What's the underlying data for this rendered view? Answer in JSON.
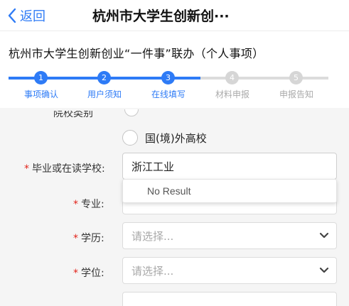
{
  "nav": {
    "back_label": "返回",
    "title": "杭州市大学生创新创···"
  },
  "heading": "杭州市大学生创新创业“一件事”联办（个人事项）",
  "steps": [
    {
      "number": "1",
      "label": "事项确认",
      "state": "done"
    },
    {
      "number": "2",
      "label": "用户须知",
      "state": "done"
    },
    {
      "number": "3",
      "label": "在线填写",
      "state": "current"
    },
    {
      "number": "4",
      "label": "材料申报",
      "state": "pending"
    },
    {
      "number": "5",
      "label": "申报告知",
      "state": "pending"
    }
  ],
  "form": {
    "cut_label": "院校类别",
    "radio_option": "国(境)外高校",
    "school": {
      "label": "毕业或在读学校:",
      "value": "浙江工业",
      "suggestion": "No Result"
    },
    "major": {
      "label": "专业:"
    },
    "education": {
      "label": "学历:",
      "placeholder": "请选择..."
    },
    "degree": {
      "label": "学位:",
      "placeholder": "请选择..."
    },
    "required_mark": "*"
  },
  "colors": {
    "accent": "#2e7bf6",
    "inactive_step": "#d6d6d6",
    "required": "#e2231a",
    "form_background": "#f5f5f5"
  },
  "icons": {
    "back": "chevron-left-icon",
    "select_caret": "chevron-down-icon"
  }
}
